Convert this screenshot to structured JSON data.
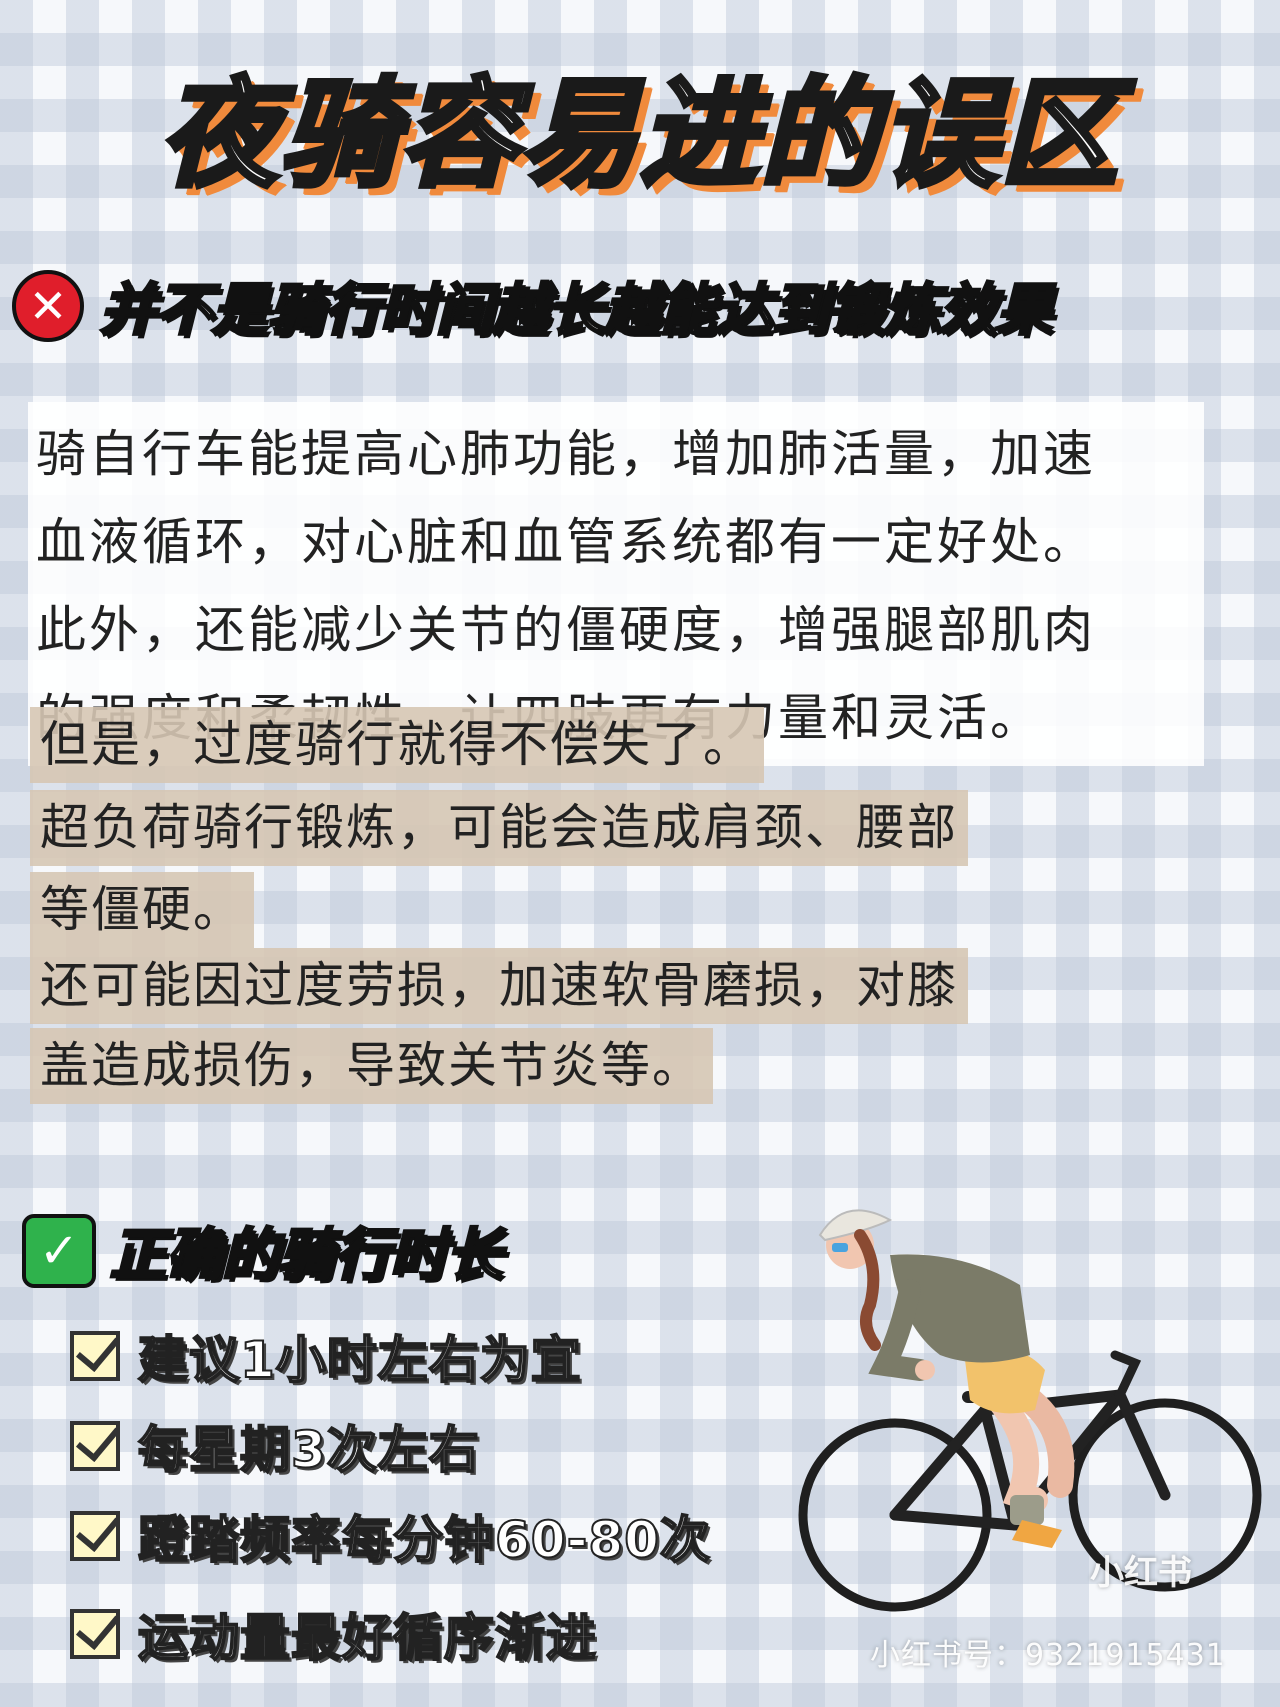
{
  "title": "夜骑容易进的误区",
  "section_wrong": {
    "icon": "red-x-icon",
    "heading": "并不是骑行时间越长越能达到锻炼效果"
  },
  "intro_lines": [
    "骑自行车能提高心肺功能，增加肺活量，加速",
    "血液循环，对心脏和血管系统都有一定好处。",
    "此外，还能减少关节的僵硬度，增强腿部肌肉",
    "的强度和柔韧性，让四肢更有力量和灵活。"
  ],
  "highlight_lines": [
    "但是，过度骑行就得不偿失了。",
    "超负荷骑行锻炼，可能会造成肩颈、腰部",
    "等僵硬。",
    "还可能因过度劳损，加速软骨磨损，对膝",
    "盖造成损伤，导致关节炎等。"
  ],
  "section_right": {
    "icon": "green-check-icon",
    "heading": "正确的骑行时长"
  },
  "tips": [
    "建议1小时左右为宜",
    "每星期3次左右",
    "蹬踏频率每分钟60-80次",
    "运动量最好循序渐进"
  ],
  "watermark": {
    "logo": "小红书",
    "id": "小红书号：9321915431"
  },
  "colors": {
    "title_shadow": "#f08a3c",
    "x_icon": "#e01e2b",
    "check_icon": "#2fb24c",
    "highlight_bg": "#d6c7b4"
  }
}
